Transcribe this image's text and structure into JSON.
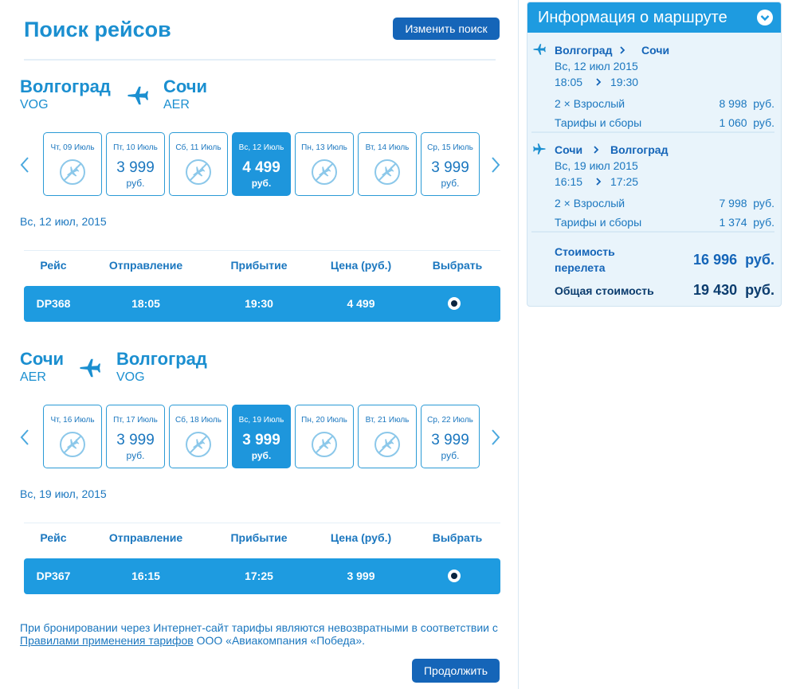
{
  "header": {
    "title": "Поиск рейсов",
    "change_label": "Изменить поиск"
  },
  "outbound": {
    "from_city": "Волгоград",
    "from_code": "VOG",
    "to_city": "Сочи",
    "to_code": "AER",
    "dates": [
      {
        "label": "Чт, 09 Июль",
        "price": "",
        "currency": "",
        "available": false
      },
      {
        "label": "Пт, 10 Июль",
        "price": "3 999",
        "currency": "руб.",
        "available": true
      },
      {
        "label": "Сб, 11 Июль",
        "price": "",
        "currency": "",
        "available": false
      },
      {
        "label": "Вс, 12 Июль",
        "price": "4 499",
        "currency": "руб.",
        "available": true,
        "selected": true
      },
      {
        "label": "Пн, 13 Июль",
        "price": "",
        "currency": "",
        "available": false
      },
      {
        "label": "Вт, 14 Июль",
        "price": "",
        "currency": "",
        "available": false
      },
      {
        "label": "Ср, 15 Июль",
        "price": "3 999",
        "currency": "руб.",
        "available": true
      }
    ],
    "selected_date": "Вс, 12 июл, 2015",
    "flight": {
      "number": "DP368",
      "depart": "18:05",
      "arrive": "19:30",
      "price": "4 499"
    }
  },
  "inbound": {
    "from_city": "Сочи",
    "from_code": "AER",
    "to_city": "Волгоград",
    "to_code": "VOG",
    "dates": [
      {
        "label": "Чт, 16 Июль",
        "price": "",
        "currency": "",
        "available": false
      },
      {
        "label": "Пт, 17 Июль",
        "price": "3 999",
        "currency": "руб.",
        "available": true
      },
      {
        "label": "Сб, 18 Июль",
        "price": "",
        "currency": "",
        "available": false
      },
      {
        "label": "Вс, 19 Июль",
        "price": "3 999",
        "currency": "руб.",
        "available": true,
        "selected": true
      },
      {
        "label": "Пн, 20 Июль",
        "price": "",
        "currency": "",
        "available": false
      },
      {
        "label": "Вт, 21 Июль",
        "price": "",
        "currency": "",
        "available": false
      },
      {
        "label": "Ср, 22 Июль",
        "price": "3 999",
        "currency": "руб.",
        "available": true
      }
    ],
    "selected_date": "Вс, 19 июл, 2015",
    "flight": {
      "number": "DP367",
      "depart": "16:15",
      "arrive": "17:25",
      "price": "3 999"
    }
  },
  "table_headers": {
    "flight": "Рейс",
    "depart": "Отправление",
    "arrive": "Прибытие",
    "price": "Цена (руб.)",
    "select": "Выбрать"
  },
  "notice": {
    "before": "При бронировании через Интернет-сайт тарифы являются невозвратными в соответствии с ",
    "link": "Правилами применения тарифов",
    "after": " ООО «Авиакомпания «Победа»."
  },
  "continue_label": "Продолжить",
  "sidebar": {
    "title": "Информация о маршруте",
    "leg1": {
      "from": "Волгоград",
      "to": "Сочи",
      "date": "Вс, 12 июл 2015",
      "depart": "18:05",
      "arrive": "19:30",
      "pax_label": "2 × Взрослый",
      "pax_price": "8 998  руб.",
      "fees_label": "Тарифы и сборы",
      "fees_price": "1 060  руб."
    },
    "leg2": {
      "from": "Сочи",
      "to": "Волгоград",
      "date": "Вс, 19 июл 2015",
      "depart": "16:15",
      "arrive": "17:25",
      "pax_label": "2 × Взрослый",
      "pax_price": "7 998  руб.",
      "fees_label": "Тарифы и сборы",
      "fees_price": "1 374  руб."
    },
    "flight_cost_label_1": "Стоимость",
    "flight_cost_label_2": "перелета",
    "flight_cost_value": "16 996  руб.",
    "total_label": "Общая стоимость",
    "total_value": "19 430  руб."
  },
  "colors": {
    "accent": "#1e9be0",
    "button": "#1565b8",
    "text": "#1b77bf",
    "sidebar_bg": "#e9f4fb"
  }
}
